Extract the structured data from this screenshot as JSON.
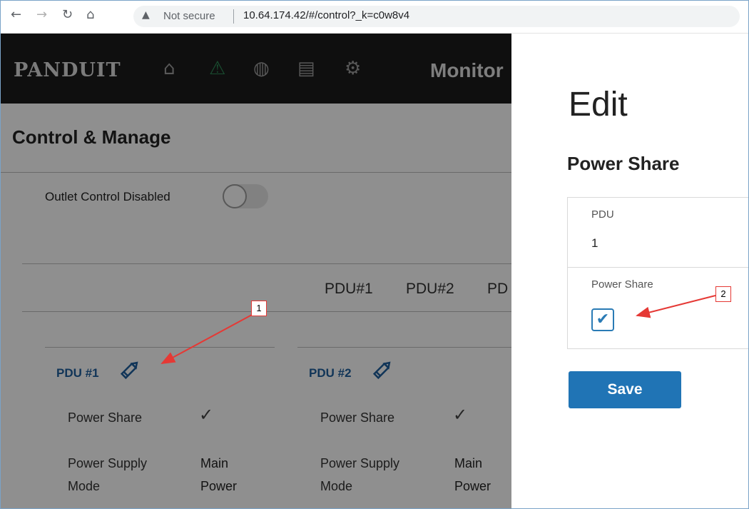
{
  "browser": {
    "warning_text": "Not secure",
    "url": "10.64.174.42/#/control?_k=c0w8v4"
  },
  "header": {
    "logo": "PANDUIT",
    "icons": [
      "home-icon",
      "alert-icon",
      "globe-icon",
      "document-icon",
      "gear-icon"
    ],
    "monitor_label": "Monitor"
  },
  "main": {
    "title": "Control & Manage",
    "outlet_control_label": "Outlet Control Disabled",
    "outlet_control_enabled": false,
    "pdu_tabs": [
      "PDU#1",
      "PDU#2",
      "PD"
    ],
    "cards": [
      {
        "heading": "PDU #1",
        "power_share_label": "Power Share",
        "power_share_checked": true,
        "mode_label_1": "Power Supply",
        "mode_label_2": "Mode",
        "mode_val_1": "Main",
        "mode_val_2": "Power"
      },
      {
        "heading": "PDU #2",
        "power_share_label": "Power Share",
        "power_share_checked": true,
        "mode_label_1": "Power Supply",
        "mode_label_2": "Mode",
        "mode_val_1": "Main",
        "mode_val_2": "Power"
      }
    ]
  },
  "edit_panel": {
    "title": "Edit",
    "subtitle": "Power Share",
    "pdu_label": "PDU",
    "pdu_value": "1",
    "power_share_label": "Power Share",
    "power_share_checked": true,
    "save_label": "Save"
  },
  "callouts": [
    "1",
    "2"
  ],
  "colors": {
    "accent": "#2074b5",
    "link": "#1f5f9e",
    "header_bg": "#1b1b1b",
    "callout_red": "#e53935"
  }
}
